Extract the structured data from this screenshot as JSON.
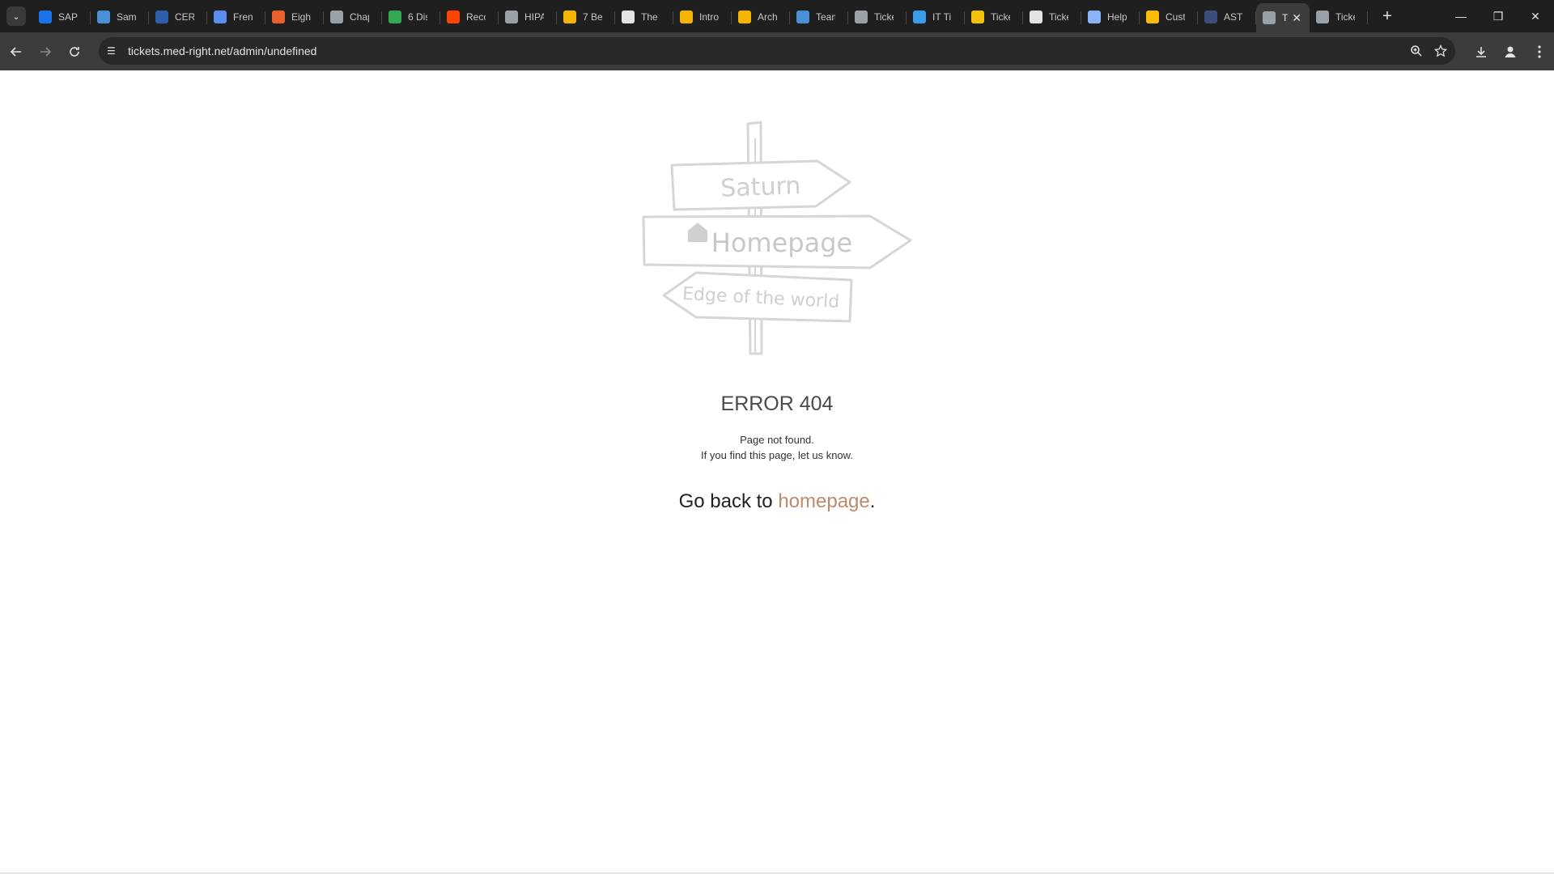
{
  "browser": {
    "tabs": [
      {
        "title": "SAP",
        "icon": "sap-icon",
        "color": "#1a73e8"
      },
      {
        "title": "Samp",
        "icon": "globe-icon",
        "color": "#4a90d9"
      },
      {
        "title": "CERN",
        "icon": "cern-icon",
        "color": "#2d5fa8"
      },
      {
        "title": "Frenc",
        "icon": "doc-icon",
        "color": "#5b8def"
      },
      {
        "title": "Eight",
        "icon": "bird-icon",
        "color": "#e8612c"
      },
      {
        "title": "Chap",
        "icon": "link-icon",
        "color": "#9aa0a6"
      },
      {
        "title": "6 Dis",
        "icon": "plus-circle-icon",
        "color": "#34a853"
      },
      {
        "title": "Reco",
        "icon": "reddit-icon",
        "color": "#ff4500"
      },
      {
        "title": "HIPA",
        "icon": "link-icon",
        "color": "#9aa0a6"
      },
      {
        "title": "7 Be",
        "icon": "hex-icon",
        "color": "#f4b400"
      },
      {
        "title": "The",
        "icon": "slash-icon",
        "color": "#e3e3e3"
      },
      {
        "title": "Intro",
        "icon": "box-icon",
        "color": "#f4b400"
      },
      {
        "title": "Arch",
        "icon": "box-icon",
        "color": "#f4b400"
      },
      {
        "title": "Team",
        "icon": "globe-icon",
        "color": "#4a90d9"
      },
      {
        "title": "Ticke",
        "icon": "ticket-icon",
        "color": "#9aa0a6"
      },
      {
        "title": "IT Ti",
        "icon": "pen-icon",
        "color": "#3b9be8"
      },
      {
        "title": "Ticke",
        "icon": "flag-icon",
        "color": "#f4c20d"
      },
      {
        "title": "Ticke",
        "icon": "p-icon",
        "color": "#e3e3e3"
      },
      {
        "title": "Help",
        "icon": "flask-icon",
        "color": "#8ab4f8"
      },
      {
        "title": "Cust",
        "icon": "chrome-icon",
        "color": "#fbbc04"
      },
      {
        "title": "ASTI",
        "icon": "asti-icon",
        "color": "#3c4c7c"
      },
      {
        "title": "T",
        "icon": "link-icon",
        "color": "#9aa0a6",
        "active": true
      },
      {
        "title": "Ticke",
        "icon": "ticket-icon",
        "color": "#9aa0a6"
      }
    ],
    "new_tab": "+",
    "url": "tickets.med-right.net/admin/undefined"
  },
  "signpost": {
    "top_sign": "Saturn",
    "middle_sign": "Homepage",
    "bottom_sign": "Edge of the world"
  },
  "error": {
    "title": "ERROR 404",
    "line1": "Page not found.",
    "line2": "If you find this page, let us know.",
    "goback_prefix": "Go back to ",
    "goback_link": "homepage",
    "goback_suffix": "."
  }
}
